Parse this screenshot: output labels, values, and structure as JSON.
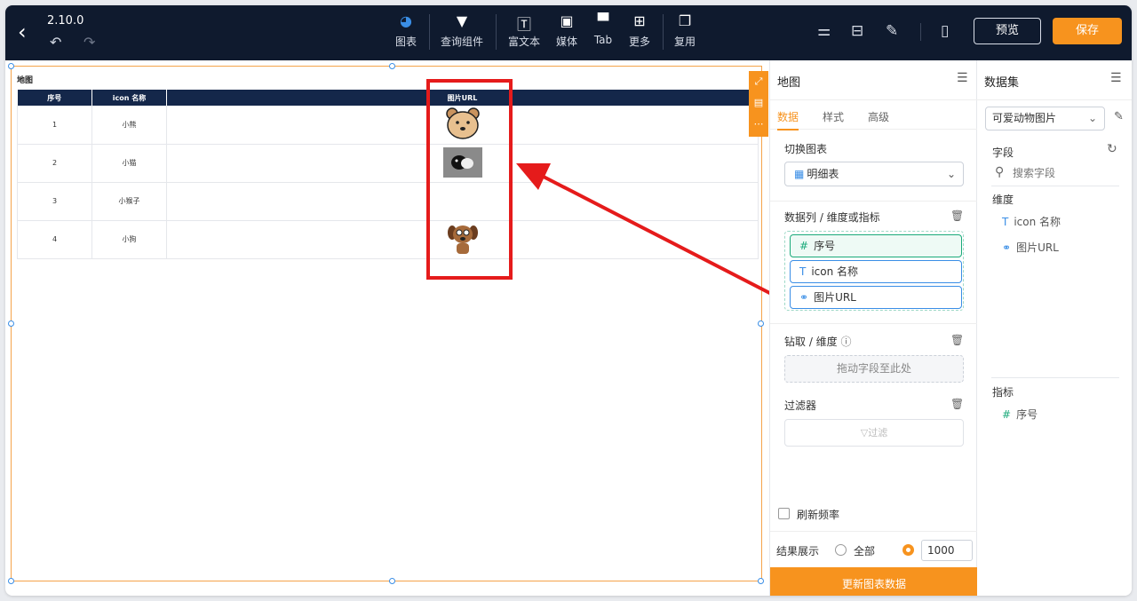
{
  "header": {
    "version": "2.10.0",
    "tools": [
      {
        "label": "图表",
        "icon": "chart-pie-icon"
      },
      {
        "label": "查询组件",
        "icon": "funnel-icon"
      },
      {
        "label": "富文本",
        "icon": "rich-text-icon"
      },
      {
        "label": "媒体",
        "icon": "image-icon"
      },
      {
        "label": "Tab",
        "icon": "tab-icon"
      },
      {
        "label": "更多",
        "icon": "grid-icon"
      },
      {
        "label": "复用",
        "icon": "copy-icon"
      }
    ],
    "preview_label": "预览",
    "save_label": "保存"
  },
  "canvas": {
    "widget_title": "地图",
    "table": {
      "columns": [
        "序号",
        "icon 名称",
        "图片URL"
      ],
      "rows": [
        {
          "index": "1",
          "name": "小熊",
          "image": "bear"
        },
        {
          "index": "2",
          "name": "小猫",
          "image": "cat"
        },
        {
          "index": "3",
          "name": "小猴子",
          "image": ""
        },
        {
          "index": "4",
          "name": "小狗",
          "image": "dog"
        }
      ]
    }
  },
  "config_panel": {
    "title": "地图",
    "tabs": [
      "数据",
      "样式",
      "高级"
    ],
    "active_tab": "数据",
    "switch_chart_label": "切换图表",
    "chart_type": "明细表",
    "columns_label": "数据列 / 维度或指标",
    "fields": [
      {
        "icon": "#",
        "label": "序号"
      },
      {
        "icon": "T",
        "label": "icon 名称"
      },
      {
        "icon": "link",
        "label": "图片URL"
      }
    ],
    "drill_label": "钻取 / 维度",
    "drill_placeholder": "拖动字段至此处",
    "filter_label": "过滤器",
    "filter_button": "▽过滤",
    "refresh_label": "刷新频率",
    "result_label": "结果展示",
    "result_all": "全部",
    "result_limit": "1000",
    "update_button": "更新图表数据"
  },
  "dataset_panel": {
    "title": "数据集",
    "dataset": "可爱动物图片",
    "fields_label": "字段",
    "search_placeholder": "搜索字段",
    "dimension_label": "维度",
    "dimensions": [
      {
        "icon": "T",
        "label": "icon 名称"
      },
      {
        "icon": "link",
        "label": "图片URL"
      }
    ],
    "metric_label": "指标",
    "metrics": [
      {
        "icon": "#",
        "label": "序号"
      }
    ]
  },
  "colors": {
    "accent": "#f7931e",
    "topbar": "#0f1a2e",
    "table_header": "#14274a",
    "annotation": "#e51b1b"
  }
}
